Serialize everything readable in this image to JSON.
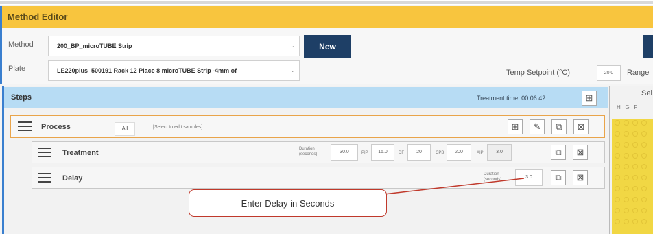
{
  "header": {
    "title": "Method Editor"
  },
  "form": {
    "method_label": "Method",
    "method_value": "200_BP_microTUBE Strip",
    "plate_label": "Plate",
    "plate_value": "LE220plus_500191 Rack 12 Place 8 microTUBE Strip -4mm of",
    "new_label": "New",
    "temp_label": "Temp Setpoint (°C)",
    "temp_value": "20.0",
    "range_label": "Range"
  },
  "steps": {
    "title": "Steps",
    "treatment_time": "Treatment time: 00:06:42",
    "process": {
      "label": "Process",
      "filter": "All",
      "hint": "[Select to edit samples]"
    },
    "treatment": {
      "label": "Treatment",
      "duration_label_1": "Duration",
      "duration_label_2": "(seconds)",
      "duration": "30.0",
      "pip_label": "PIP",
      "pip": "15.0",
      "df_label": "DF",
      "df": "20",
      "cpb_label": "CPB",
      "cpb": "200",
      "aip_label": "AIP",
      "aip": "3.0"
    },
    "delay": {
      "label": "Delay",
      "duration_label_1": "Duration",
      "duration_label_2": "(seconds)",
      "duration": "3.0"
    }
  },
  "select_panel": {
    "title": "Sel",
    "col_h": "H",
    "col_g": "G",
    "col_f": "F"
  },
  "callout": {
    "text": "Enter Delay in Seconds"
  },
  "colors": {
    "header": "#f8c53e",
    "steps_header": "#b7dcf4",
    "new_button": "#1e3f66",
    "process_border": "#e9a44a",
    "plate_grid": "#f1d744",
    "callout_border": "#c0392b"
  },
  "icons": [
    "chevron-down-icon",
    "add-icon",
    "edit-icon",
    "copy-icon",
    "delete-icon",
    "drag-handle-icon"
  ]
}
